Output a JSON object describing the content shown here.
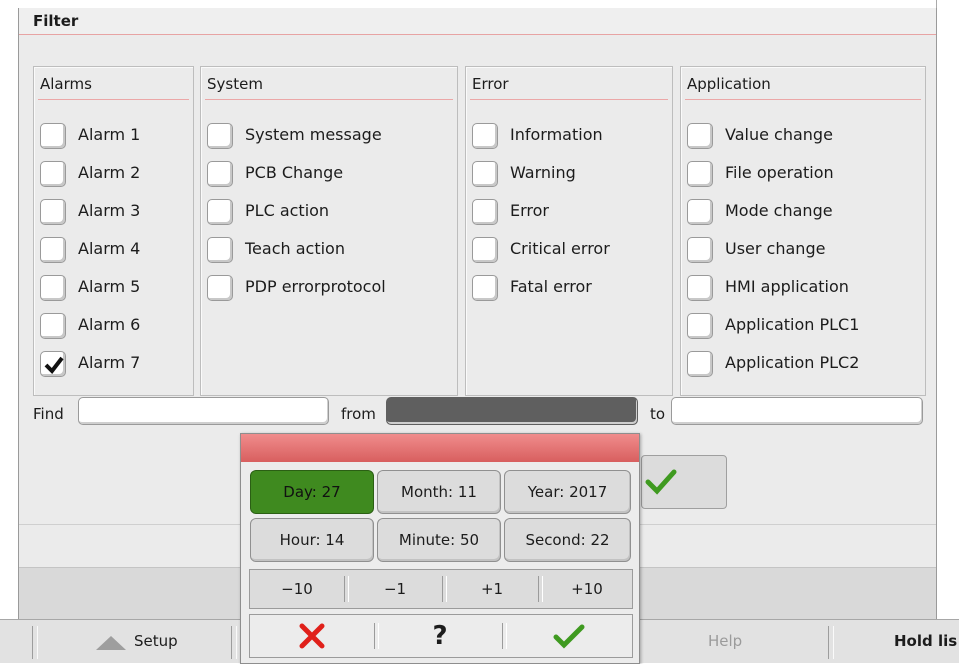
{
  "filter_title": "Filter",
  "groups": [
    {
      "title": "Alarms",
      "items": [
        {
          "label": "Alarm 1",
          "checked": false
        },
        {
          "label": "Alarm 2",
          "checked": false
        },
        {
          "label": "Alarm 3",
          "checked": false
        },
        {
          "label": "Alarm 4",
          "checked": false
        },
        {
          "label": "Alarm 5",
          "checked": false
        },
        {
          "label": "Alarm 6",
          "checked": false
        },
        {
          "label": "Alarm 7",
          "checked": true
        }
      ]
    },
    {
      "title": "System",
      "items": [
        {
          "label": "System message",
          "checked": false
        },
        {
          "label": "PCB Change",
          "checked": false
        },
        {
          "label": "PLC action",
          "checked": false
        },
        {
          "label": "Teach action",
          "checked": false
        },
        {
          "label": "PDP errorprotocol",
          "checked": false
        }
      ]
    },
    {
      "title": "Error",
      "items": [
        {
          "label": "Information",
          "checked": false
        },
        {
          "label": "Warning",
          "checked": false
        },
        {
          "label": "Error",
          "checked": false
        },
        {
          "label": "Critical error",
          "checked": false
        },
        {
          "label": "Fatal error",
          "checked": false
        }
      ]
    },
    {
      "title": "Application",
      "items": [
        {
          "label": "Value change",
          "checked": false
        },
        {
          "label": "File operation",
          "checked": false
        },
        {
          "label": "Mode change",
          "checked": false
        },
        {
          "label": "User change",
          "checked": false
        },
        {
          "label": "HMI application",
          "checked": false
        },
        {
          "label": "Application PLC1",
          "checked": false
        },
        {
          "label": "Application PLC2",
          "checked": false
        }
      ]
    }
  ],
  "find": {
    "label": "Find",
    "value": ""
  },
  "from": {
    "label": "from",
    "value": ""
  },
  "to": {
    "label": "to",
    "value": ""
  },
  "date_dialog": {
    "fields": [
      {
        "label": "Day: 27",
        "active": true
      },
      {
        "label": "Month: 11",
        "active": false
      },
      {
        "label": "Year: 2017",
        "active": false
      },
      {
        "label": "Hour: 14",
        "active": false
      },
      {
        "label": "Minute: 50",
        "active": false
      },
      {
        "label": "Second: 22",
        "active": false
      }
    ],
    "steps": [
      "−10",
      "−1",
      "+1",
      "+10"
    ],
    "actions": [
      "cancel-icon",
      "help-icon",
      "confirm-icon"
    ],
    "help_glyph": "?"
  },
  "softkeys": {
    "setup": "Setup",
    "help": "Help",
    "hold_list": "Hold lis"
  },
  "colors": {
    "active_green": "#3f8a1f",
    "check_green": "#3f9a20",
    "cancel_red": "#e0201a",
    "header_red": "#e07070"
  }
}
